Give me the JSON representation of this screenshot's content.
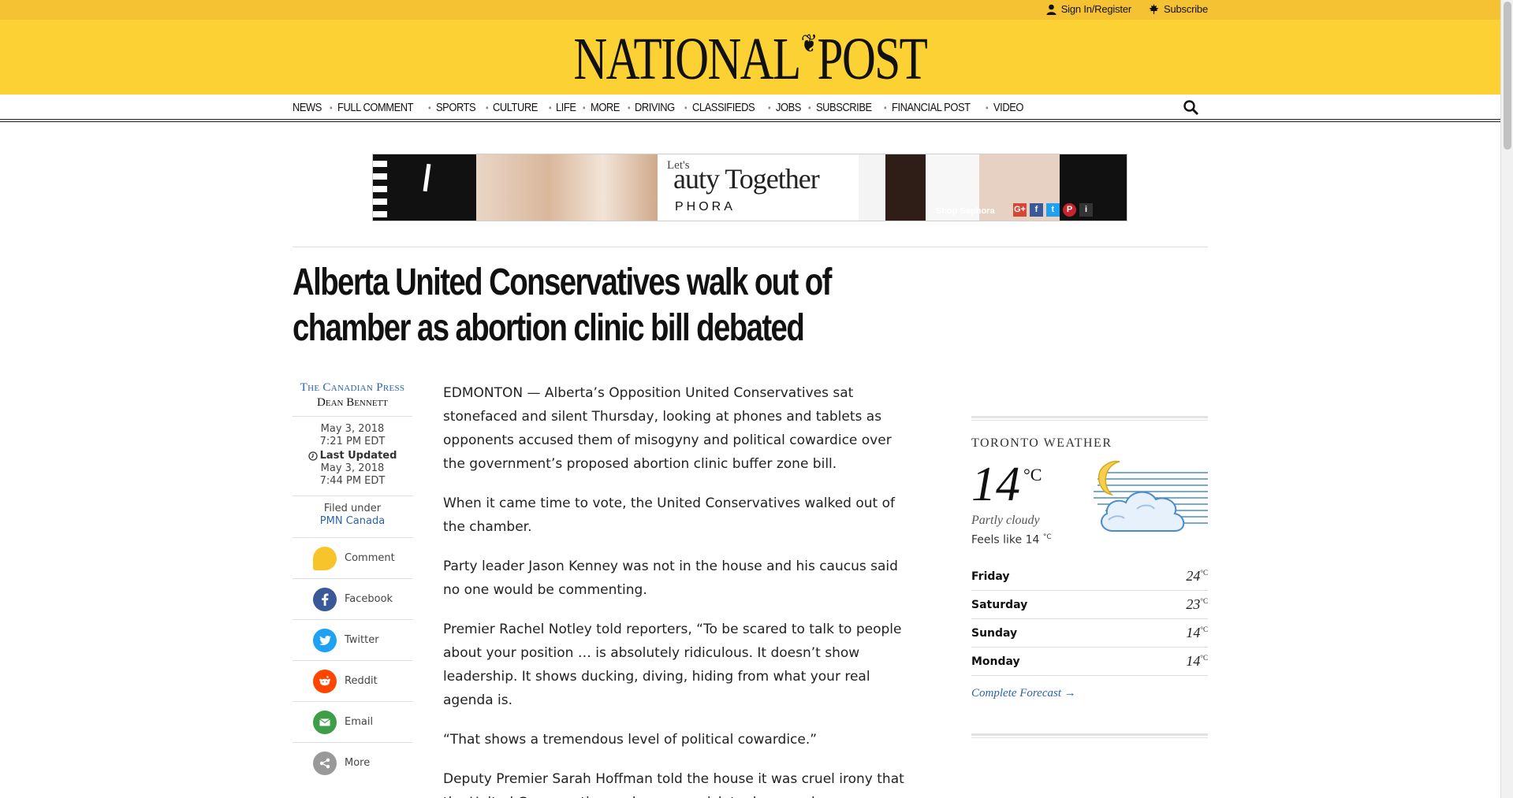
{
  "utility": {
    "sign_in": "Sign In/Register",
    "subscribe": "Subscribe"
  },
  "masthead": {
    "logo_left": "NATIONAL",
    "logo_right": "POST",
    "bg_color": "#fbd133"
  },
  "nav": {
    "items": [
      "NEWS",
      "FULL COMMENT",
      "SPORTS",
      "CULTURE",
      "LIFE",
      "MORE",
      "DRIVING",
      "CLASSIFIEDS",
      "JOBS",
      "SUBSCRIBE",
      "FINANCIAL POST",
      "VIDEO"
    ],
    "search_icon": "search-icon"
  },
  "ad": {
    "tag_small": "Let's",
    "tag_big": "auty Together",
    "tag_brand": "PHORA",
    "shop": "Shop Sephora",
    "socials": [
      "G+",
      "f",
      "t",
      "P",
      "i"
    ]
  },
  "article": {
    "headline": "Alberta United Conservatives walk out of chamber as abortion clinic bill debated",
    "source": "The Canadian Press",
    "author": "Dean Bennett",
    "published_date": "May 3, 2018",
    "published_time": "7:21 PM EDT",
    "updated_label": "Last Updated",
    "updated_date": "May 3, 2018",
    "updated_time": "7:44 PM EDT",
    "filed_label": "Filed under",
    "filed_link": "PMN Canada",
    "share": {
      "comment": "Comment",
      "facebook": "Facebook",
      "twitter": "Twitter",
      "reddit": "Reddit",
      "email": "Email",
      "more": "More"
    },
    "paragraphs": [
      "EDMONTON — Alberta’s Opposition United Conservatives sat stonefaced and silent Thursday, looking at phones and tablets as opponents accused them of misogyny and political cowardice over the government’s proposed abortion clinic buffer zone bill.",
      "When it came time to vote, the United Conservatives walked out of the chamber.",
      "Party leader Jason Kenney was not in the house and his caucus said no one would be commenting.",
      "Premier Rachel Notley told reporters, “To be scared to talk to people about your position … is absolutely ridiculous. It doesn’t show leadership. It shows ducking, diving, hiding from what your real agenda is.",
      "“That shows a tremendous level of political cowardice.”",
      "Deputy Premier Sarah Hoffman told the house it was cruel irony that the United Conservatives, who were quick to decry and..."
    ]
  },
  "weather": {
    "title": "TORONTO WEATHER",
    "temp": "14",
    "unit": "°C",
    "condition": "Partly cloudy",
    "feels_like": "Feels like 14",
    "feels_unit": "°C",
    "forecast": [
      {
        "day": "Friday",
        "temp": "24"
      },
      {
        "day": "Saturday",
        "temp": "23"
      },
      {
        "day": "Sunday",
        "temp": "14"
      },
      {
        "day": "Monday",
        "temp": "14"
      }
    ],
    "forecast_unit": "°C",
    "complete_link": "Complete Forecast →"
  }
}
